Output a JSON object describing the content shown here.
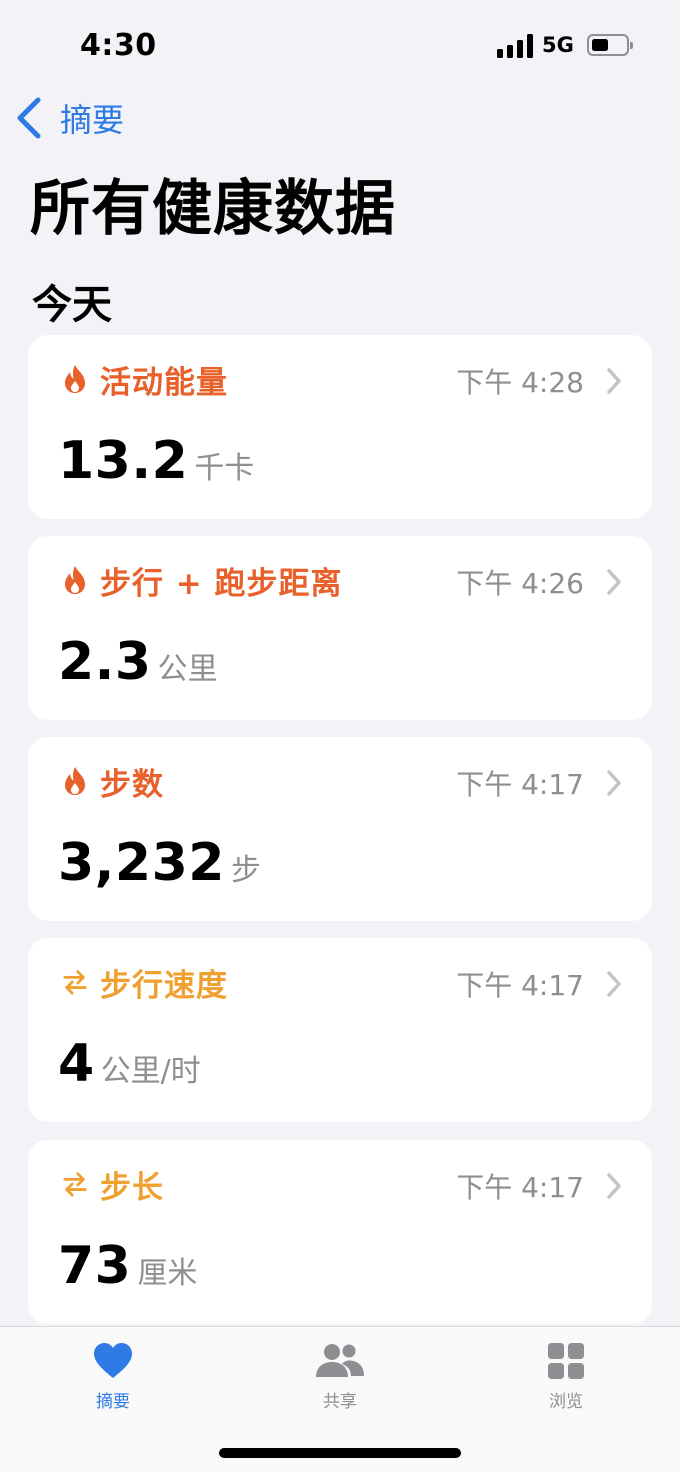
{
  "status": {
    "time": "4:30",
    "network": "5G"
  },
  "nav": {
    "back_label": "摘要"
  },
  "page_title": "所有健康数据",
  "section_header": "今天",
  "colors": {
    "accent_blue": "#2f7ae5",
    "activity_orange": "#e8602a",
    "mobility_amber": "#f0a030"
  },
  "cards": [
    {
      "icon": "flame-icon",
      "category": "活动能量",
      "time": "下午 4:28",
      "value": "13.2",
      "unit": "千卡"
    },
    {
      "icon": "flame-icon",
      "category": "步行 + 跑步距离",
      "time": "下午 4:26",
      "value": "2.3",
      "unit": "公里"
    },
    {
      "icon": "flame-icon",
      "category": "步数",
      "time": "下午 4:17",
      "value": "3,232",
      "unit": "步"
    },
    {
      "icon": "arrows-swap-icon",
      "category": "步行速度",
      "time": "下午 4:17",
      "value": "4",
      "unit": "公里/时"
    },
    {
      "icon": "arrows-swap-icon",
      "category": "步长",
      "time": "下午 4:17",
      "value": "73",
      "unit": "厘米"
    }
  ],
  "tabs": [
    {
      "icon": "heart-icon",
      "label": "摘要",
      "active": true
    },
    {
      "icon": "people-icon",
      "label": "共享",
      "active": false
    },
    {
      "icon": "grid-icon",
      "label": "浏览",
      "active": false
    }
  ]
}
